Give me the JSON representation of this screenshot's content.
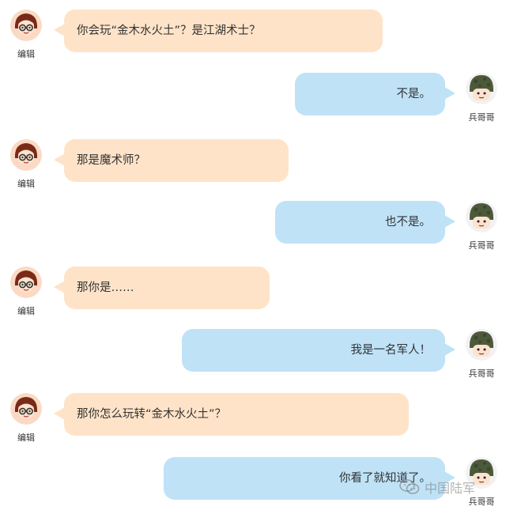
{
  "speakers": {
    "editor": "编辑",
    "soldier": "兵哥哥"
  },
  "messages": [
    {
      "from": "editor",
      "text": "你会玩“金木水火土”？是江湖术士？"
    },
    {
      "from": "soldier",
      "text": "不是。"
    },
    {
      "from": "editor",
      "text": "那是魔术师？"
    },
    {
      "from": "soldier",
      "text": "也不是。"
    },
    {
      "from": "editor",
      "text": "那你是……"
    },
    {
      "from": "soldier",
      "text": "我是一名军人！"
    },
    {
      "from": "editor",
      "text": "那你怎么玩转“金木水火土”？"
    },
    {
      "from": "soldier",
      "text": "你看了就知道了。"
    }
  ],
  "watermark": {
    "text": "中国陆军",
    "icon": "wechat-icon"
  },
  "colors": {
    "editor_bubble": "#ffe3c8",
    "soldier_bubble": "#bfe2f7"
  }
}
